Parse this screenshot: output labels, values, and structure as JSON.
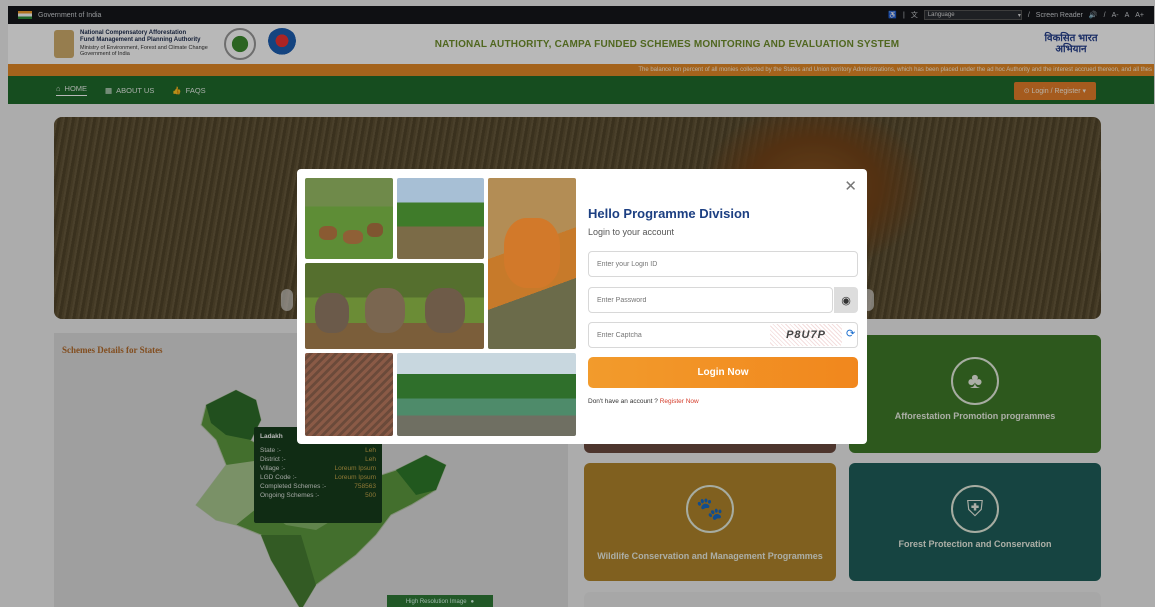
{
  "gov_bar": {
    "left_text": "Government of India",
    "language_label": "Language",
    "screen_reader": "Screen Reader",
    "font_sizes": [
      "A-",
      "A",
      "A+"
    ]
  },
  "header": {
    "org_line1": "National Compensatory Afforestation",
    "org_line2": "Fund Management and Planning Authority",
    "org_line3": "Ministry of Environment, Forest and Climate Change",
    "org_line4": "Government of India",
    "title": "NATIONAL AUTHORITY, CAMPA FUNDED SCHEMES MONITORING AND EVALUATION SYSTEM",
    "brand_line1": "विकसित भारत",
    "brand_line2": "अभियान"
  },
  "ticker": "The balance ten percent of all monies collected by the States and Union territory Administrations, which has been placed under the ad hoc Authority and the interest accrued thereon, and all thes",
  "nav": {
    "home": "HOME",
    "about": "ABOUT US",
    "faqs": "FAQS",
    "login_register": "Login / Register"
  },
  "states": {
    "title": "Schemes Details for States",
    "tooltip": {
      "name": "Ladakh",
      "rows": [
        {
          "label": "State :-",
          "value": "Leh"
        },
        {
          "label": "District :-",
          "value": "Leh"
        },
        {
          "label": "Village :-",
          "value": "Loreum Ipsum"
        },
        {
          "label": "LGD Code :-",
          "value": "Loreum Ipsum"
        },
        {
          "label": "Completed Schemes :-",
          "value": "758563"
        },
        {
          "label": "Ongoing Schemes :-",
          "value": "500"
        }
      ]
    },
    "hi_res": "High Resolution Image"
  },
  "tiles": {
    "afforestation": "Afforestation Promotion programmes",
    "wildlife": "Wildlife Conservation and Management Programmes",
    "forest": "Forest Protection and Conservation"
  },
  "modal": {
    "heading": "Hello Programme Division",
    "subheading": "Login to your account",
    "login_placeholder": "Enter your Login ID",
    "password_placeholder": "Enter Password",
    "captcha_placeholder": "Enter Captcha",
    "captcha_text": "P8U7P",
    "login_button": "Login Now",
    "no_account": "Don't have an account ?",
    "register_link": "Register Now"
  }
}
